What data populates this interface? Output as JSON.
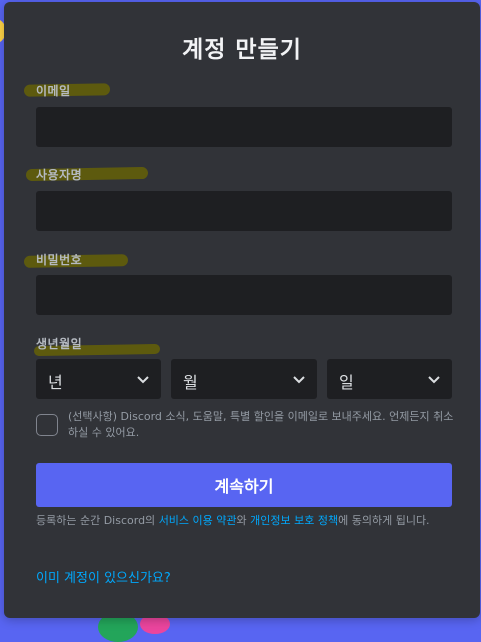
{
  "title": "계정 만들기",
  "fields": {
    "email_label": "이메일",
    "username_label": "사용자명",
    "password_label": "비밀번호",
    "birthdate_label": "생년월일"
  },
  "birthdate": {
    "year_placeholder": "년",
    "month_placeholder": "월",
    "day_placeholder": "일"
  },
  "opt_in_text": "(선택사항) Discord 소식, 도움말, 특별 할인을 이메일로 보내주세요. 언제든지 취소하실 수 있어요.",
  "continue_label": "계속하기",
  "legal": {
    "prefix": "등록하는 순간 Discord의 ",
    "terms_link": "서비스 이용 약관",
    "middle": "와 ",
    "privacy_link": "개인정보 보호 정책",
    "suffix": "에 동의하게 됩니다."
  },
  "login_link": "이미 계정이 있으신가요?",
  "colors": {
    "brand": "#5865f2",
    "card": "#313338",
    "input": "#1e1f22",
    "link": "#00a8fc",
    "highlight": "#6c6800"
  }
}
